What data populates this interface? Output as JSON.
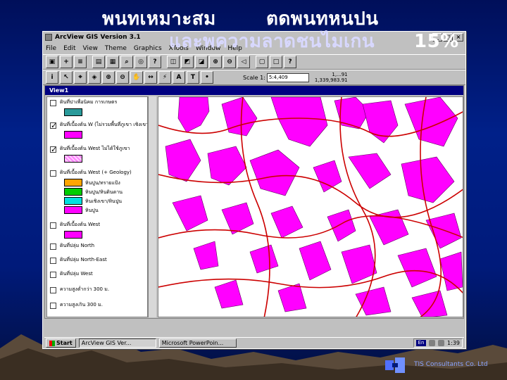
{
  "slide": {
    "title_part1": "พนทเหมาะสม",
    "title_part2": "ตดพนทหนปน",
    "title_part3": "และพความลาดชนไมเกน",
    "title_part4": "15%",
    "footer": "TIS Consultants Co. Ltd"
  },
  "window": {
    "title": "ArcView GIS Version 3.1",
    "controls": [
      "_",
      "□",
      "×"
    ]
  },
  "menu": [
    "File",
    "Edit",
    "View",
    "Theme",
    "Graphics",
    "XTools",
    "Window",
    "Help"
  ],
  "toolbar": {
    "scale_label": "Scale 1:",
    "scale_value": "5:4,409",
    "coord_x": "1,...91",
    "coord_y": "1,339,983.91"
  },
  "view": {
    "title": "View1"
  },
  "toc": {
    "layers": [
      {
        "label": "ดินที่ปาเพื่อนิคม การเกษตร",
        "checked": false,
        "swatch": "#2a9a9a"
      },
      {
        "label": "ดินที่เบื้องต้น W (ไม่รวมพื้นที่ภูเขา เชิงเขา)",
        "checked": true,
        "swatch": "#ff00ff"
      },
      {
        "label": "ดินที่เบื้องต้น West ไม่ได้ใช้ภูเขา",
        "checked": true,
        "swatch": "#ffc0ff"
      },
      {
        "label": "ดินที่เบื้องต้น West (+ Geology)",
        "checked": false
      },
      {
        "label": "ดินที่เบื้องต้น West",
        "checked": false,
        "swatch": "#ff00ff"
      },
      {
        "label": "ดินที่ปลุ่ม North",
        "checked": false
      },
      {
        "label": "ดินที่ปลุ่ม North-East",
        "checked": false
      },
      {
        "label": "ดินที่ปลุ่ม West",
        "checked": false
      },
      {
        "label": "ความสูงต่ำกว่า 300 ม.",
        "checked": false
      },
      {
        "label": "ความสูงเกิน 300 ม.",
        "checked": false
      }
    ],
    "geology_items": [
      {
        "label": "หินปูน/ทรายแป้ง",
        "color": "#ffa500"
      },
      {
        "label": "หินปูน/หินดินดาน",
        "color": "#00cc00"
      },
      {
        "label": "หินเชิงเขา/หินปูน",
        "color": "#00e0e0"
      },
      {
        "label": "หินปูน",
        "color": "#ff00ff"
      }
    ]
  },
  "taskbar": {
    "start": "Start",
    "items": [
      "ArcView GIS Ver...",
      "Microsoft PowerPoin..."
    ],
    "tray_lang": "En",
    "clock": "1:39"
  },
  "colors": {
    "polygon_fill": "#ff00ff",
    "road": "#cc0000",
    "slide_bg": "#001a7a"
  }
}
